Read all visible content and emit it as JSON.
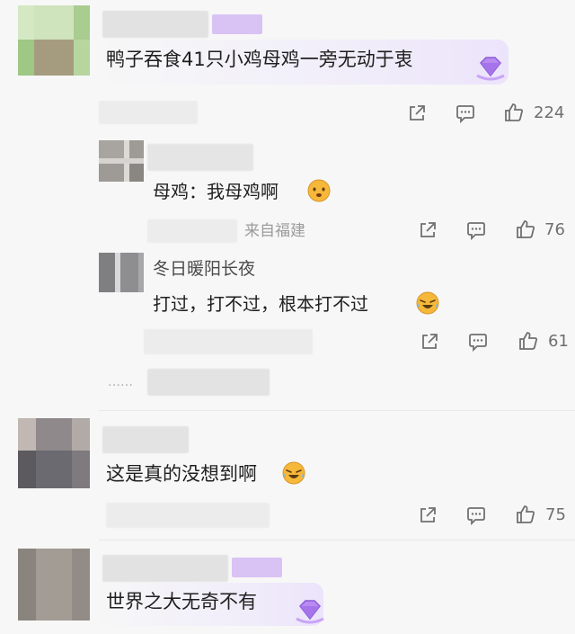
{
  "comments": [
    {
      "text": "鸭子吞食41只小鸡母鸡一旁无动于衷",
      "likes": "224",
      "replies": [
        {
          "text": "母鸡：我母鸡啊",
          "location": "来自福建",
          "likes": "76"
        },
        {
          "author": "冬日暖阳长夜",
          "text": "打过，打不过，根本打不过",
          "likes": "61"
        }
      ],
      "more_replies_dots": "……"
    },
    {
      "text": "这是真的没想到啊",
      "likes": "75"
    },
    {
      "text": "世界之大无奇不有"
    }
  ],
  "icons": {
    "share": "share-icon",
    "comment": "comment-icon",
    "like": "thumbs-up-icon"
  },
  "colors": {
    "background": "#f7f7f7",
    "text": "#1f1f1f",
    "meta": "#9b9b9b",
    "vip_tag": "#d9c3f4",
    "emoji": "#f6b83a"
  }
}
